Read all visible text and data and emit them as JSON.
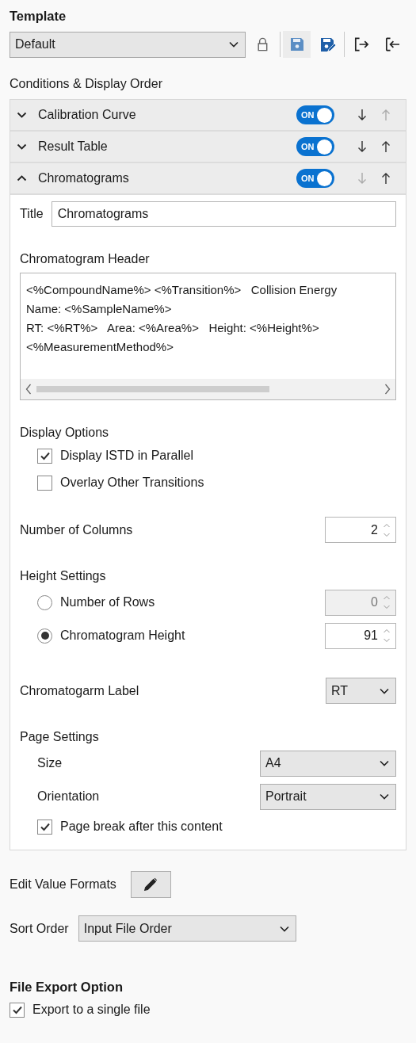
{
  "template": {
    "heading": "Template",
    "selected": "Default"
  },
  "conditions": {
    "heading": "Conditions & Display Order",
    "sections": [
      {
        "title": "Calibration Curve",
        "expanded": false,
        "on": true,
        "toggle_label": "ON",
        "down_enabled": true,
        "up_enabled": false
      },
      {
        "title": "Result Table",
        "expanded": false,
        "on": true,
        "toggle_label": "ON",
        "down_enabled": true,
        "up_enabled": true
      },
      {
        "title": "Chromatograms",
        "expanded": true,
        "on": true,
        "toggle_label": "ON",
        "down_enabled": false,
        "up_enabled": true
      }
    ]
  },
  "chromatograms": {
    "title_label": "Title",
    "title_value": "Chromatograms",
    "header_label": "Chromatogram Header",
    "header_lines": [
      "<%CompoundName%> <%Transition%>   Collision Energy",
      "Name: <%SampleName%>",
      "RT: <%RT%>   Area: <%Area%>   Height: <%Height%>",
      "<%MeasurementMethod%>"
    ],
    "display_options": {
      "heading": "Display Options",
      "options": [
        {
          "label": "Display ISTD in Parallel",
          "checked": true
        },
        {
          "label": "Overlay Other Transitions",
          "checked": false
        }
      ]
    },
    "columns": {
      "label": "Number of Columns",
      "value": "2"
    },
    "height_settings": {
      "heading": "Height Settings",
      "options": [
        {
          "label": "Number of Rows",
          "selected": false,
          "value": "0"
        },
        {
          "label": "Chromatogram Height",
          "selected": true,
          "value": "91"
        }
      ]
    },
    "label_setting": {
      "label": "Chromatogarm Label",
      "value": "RT"
    },
    "page_settings": {
      "heading": "Page Settings",
      "size_label": "Size",
      "size": "A4",
      "orientation_label": "Orientation",
      "orientation": "Portrait",
      "page_break": {
        "label": "Page break after this content",
        "checked": true
      }
    }
  },
  "edit_value_formats": {
    "label": "Edit Value Formats"
  },
  "sort_order": {
    "label": "Sort Order",
    "value": "Input File Order"
  },
  "file_export": {
    "heading": "File Export Option",
    "single_file": {
      "label": "Export to a single file",
      "checked": true
    }
  }
}
